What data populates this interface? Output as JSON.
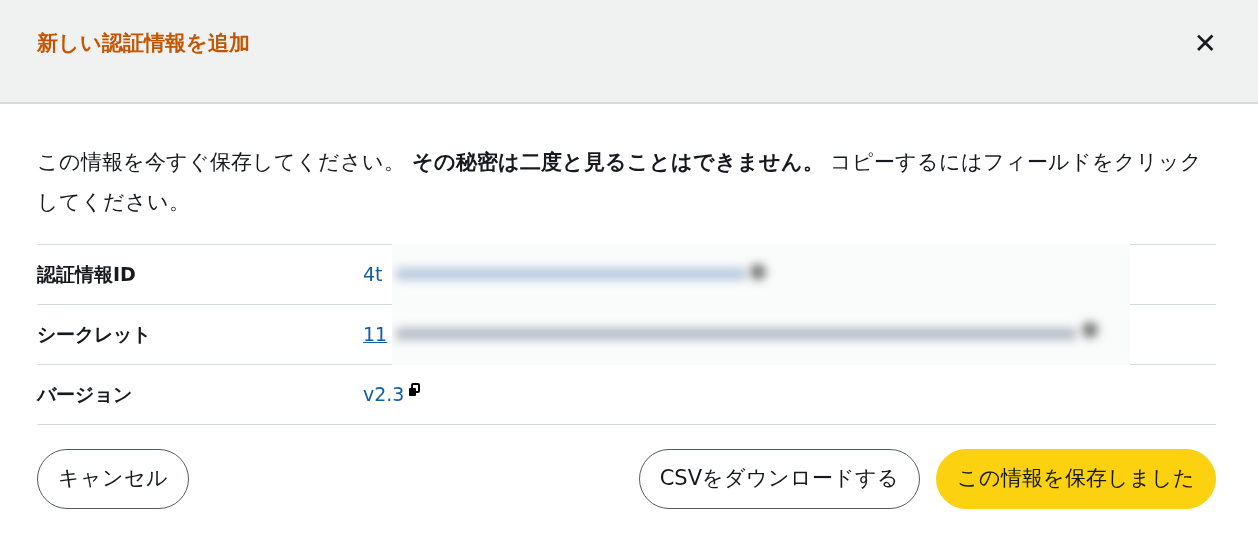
{
  "dialog": {
    "title": "新しい認証情報を追加",
    "close": "✕",
    "message": "この情報を今すぐ保存してください。 **その秘密は二度と見ることはできません。** コピーするにはフィールドをクリックしてください。",
    "rows": [
      {
        "label": "認証情報ID",
        "value": "4t",
        "underlined": false,
        "copy_icon": false
      },
      {
        "label": "シークレット",
        "value": "11",
        "underlined": true,
        "copy_icon": false
      },
      {
        "label": "バージョン",
        "value": "v2.3",
        "underlined": false,
        "copy_icon": true
      }
    ],
    "buttons": [
      {
        "label": "キャンセル",
        "kind": "secondary"
      },
      {
        "label": "CSVをダウンロードする",
        "kind": "secondary"
      },
      {
        "label": "この情報を保存しました",
        "kind": "primary"
      }
    ]
  }
}
